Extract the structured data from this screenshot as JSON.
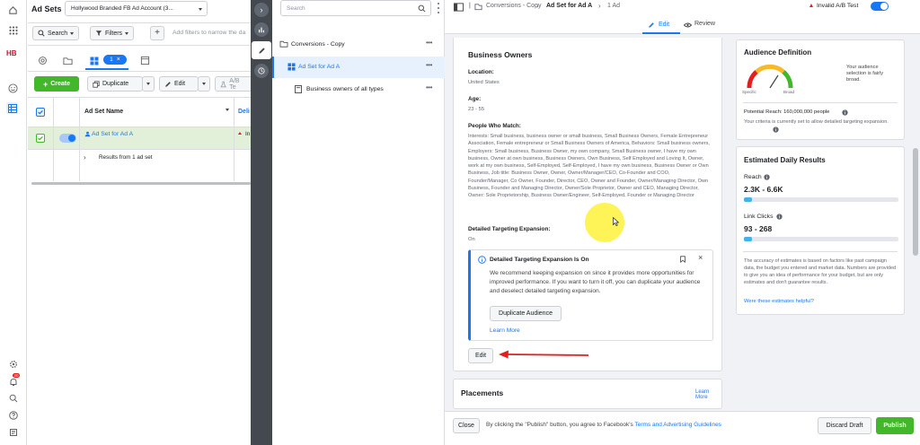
{
  "leftbar": {
    "logo": "HB",
    "notif_badge": "20"
  },
  "manager": {
    "title": "Ad Sets",
    "account": "Hollywood Branded FB Ad Account (3...",
    "search_label": "Search",
    "filters_label": "Filters",
    "filter_placeholder": "Add filters to narrow the da",
    "selected_count": "1",
    "create_label": "Create",
    "duplicate_label": "Duplicate",
    "edit_label": "Edit",
    "ab_test_label": "A/B Te",
    "col_name": "Ad Set Name",
    "col_next": "Deli",
    "row_name": "Ad Set for Ad A",
    "row_status": "In",
    "results_label": "Results from 1 ad set"
  },
  "tree": {
    "search_placeholder": "Search",
    "campaign": "Conversions - Copy",
    "adset": "Ad Set for Ad A",
    "ad": "Business owners of all types"
  },
  "editor": {
    "breadcrumb_campaign": "Conversions - Copy",
    "breadcrumb_adset": "Ad Set for Ad A",
    "breadcrumb_ad": "1 Ad",
    "invalid_label": "Invalid A/B Test",
    "tab_edit": "Edit",
    "tab_review": "Review",
    "audience": {
      "title": "Business Owners",
      "location_label": "Location:",
      "location_value": "United States",
      "age_label": "Age:",
      "age_value": "23 - 55",
      "match_label": "People Who Match:",
      "match_value": "Interests: Small business, business owner or small business, Small Business Owners, Female Entrepreneur Association, Female entrepreneur or Small Business Owners of America, Behaviors: Small business owners, Employers: Small business, Business Owner, my own company, Small Business owner, I have my own business, Owner at own business, Business Owners, Own Business, Self Employed and Loving It, Owner, work at my own business, Self-Employed, Self-Employed, I have my own business, Business Owner or Own Business, Job title: Business Owner, Owner, Owner/Manager/CEO, Co-Founder and COO, Founder/Manager, Co Owner, Founder, Director, CEO, Owner and Founder, Owner/Managing Director, Own Business, Founder and Managing Director, Owner/Sole Proprietor, Owner and CEO, Managing Director, Owner: Sole Proprietorship, Business Owner/Engineer, Self-Employed, Founder or Managing Director",
      "expansion_label": "Detailed Targeting Expansion:",
      "expansion_value": "On"
    },
    "notice": {
      "title": "Detailed Targeting Expansion Is On",
      "body": "We recommend keeping expansion on since it provides more opportunities for improved performance. If you want to turn it off, you can duplicate your audience and deselect detailed targeting expansion.",
      "dup_button": "Duplicate Audience",
      "learn_more": "Learn More"
    },
    "edit_button": "Edit",
    "placements_title": "Placements",
    "placements_link": "Learn More",
    "definition": {
      "title": "Audience Definition",
      "gauge_specific": "Specific",
      "gauge_broad": "Broad",
      "desc": "Your audience selection is fairly broad.",
      "reach": "Potential Reach: 160,000,000 people",
      "criteria": "Your criteria is currently set to allow detailed targeting expansion."
    },
    "estimates": {
      "title": "Estimated Daily Results",
      "reach_label": "Reach",
      "reach_value": "2.3K - 6.6K",
      "reach_fill": 0.05,
      "clicks_label": "Link Clicks",
      "clicks_value": "93 - 268",
      "clicks_fill": 0.05,
      "note": "The accuracy of estimates is based on factors like past campaign data, the budget you entered and market data. Numbers are provided to give you an idea of performance for your budget, but are only estimates and don't guarantee results.",
      "helpful": "Were these estimates helpful?"
    },
    "footer": {
      "close": "Close",
      "notice_pre": "By clicking the \"Publish\" button, you agree to Facebook's",
      "terms": "Terms and Advertising Guidelines",
      "discard": "Discard Draft",
      "publish": "Publish"
    }
  },
  "colors": {
    "accent": "#1877f2",
    "green": "#42b72a",
    "red": "#e41e1e",
    "highlight": "#fff23a"
  }
}
